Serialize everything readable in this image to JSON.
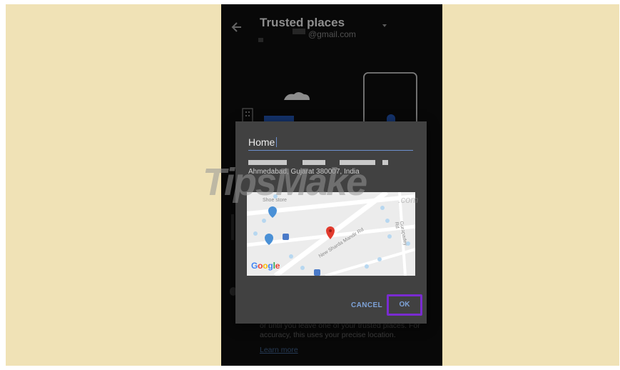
{
  "header": {
    "back_icon": "arrow-left-icon",
    "title": "Trusted places",
    "account": "@gmail.com",
    "dropdown_icon": "caret-down-icon"
  },
  "dialog": {
    "name_value": "Home",
    "address_line2": "Ahmedabad, Gujarat 380007, India",
    "map": {
      "logo": "Google",
      "labels": [
        "Shoe store",
        "New Sharda Mandir Rd",
        "Gurapadey Rd"
      ],
      "pin_icon": "map-pin-icon"
    },
    "cancel_label": "CANCEL",
    "ok_label": "OK",
    "highlight_color": "#7a2bd1"
  },
  "background": {
    "footer_text": "or until you leave one of your trusted places. For accuracy, this uses your precise location.",
    "learn_more": "Learn more"
  },
  "watermark": {
    "text": "TipsMake",
    "suffix": ".com"
  }
}
